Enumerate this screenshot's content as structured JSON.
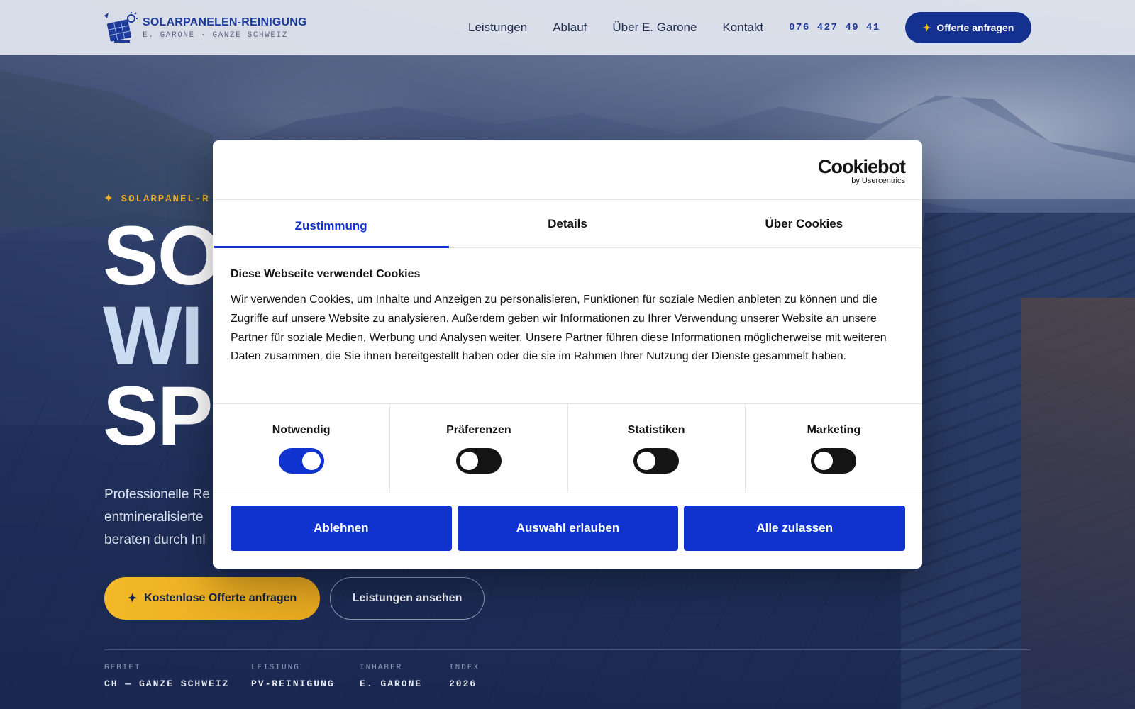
{
  "header": {
    "logo_title": "SOLARPANELEN-REINIGUNG",
    "logo_subtitle": "E. GARONE · GANZE SCHWEIZ",
    "nav": {
      "services": "Leistungen",
      "process": "Ablauf",
      "about": "Über E. Garone",
      "contact": "Kontakt",
      "phone": "076 427 49 41"
    },
    "cta": "Offerte anfragen"
  },
  "hero": {
    "eyebrow": "SOLARPANEL-R",
    "headline_line1": "SO",
    "headline_line2": "WI",
    "headline_line3": "SP",
    "lead_line1": "Professionelle Re",
    "lead_line2": "entmineralisierte",
    "lead_line3": "beraten durch Inl",
    "primary_button": "Kostenlose Offerte anfragen",
    "secondary_button": "Leistungen ansehen",
    "meta": [
      {
        "key": "GEBIET",
        "value": "CH — GANZE SCHWEIZ"
      },
      {
        "key": "LEISTUNG",
        "value": "PV-REINIGUNG"
      },
      {
        "key": "INHABER",
        "value": "E. GARONE"
      },
      {
        "key": "INDEX",
        "value": "2026"
      }
    ]
  },
  "cookie_dialog": {
    "brand_name": "Cookiebot",
    "brand_by": "by Usercentrics",
    "tabs": [
      "Zustimmung",
      "Details",
      "Über Cookies"
    ],
    "active_tab": "Zustimmung",
    "title": "Diese Webseite verwendet Cookies",
    "text": "Wir verwenden Cookies, um Inhalte und Anzeigen zu personalisieren, Funktionen für soziale Medien anbieten zu können und die Zugriffe auf unsere Website zu analysieren. Außerdem geben wir Informationen zu Ihrer Verwendung unserer Website an unsere Partner für soziale Medien, Werbung und Analysen weiter. Unsere Partner führen diese Informationen möglicherweise mit weiteren Daten zusammen, die Sie ihnen bereitgestellt haben oder die sie im Rahmen Ihrer Nutzung der Dienste gesammelt haben.",
    "categories": [
      {
        "label": "Notwendig",
        "enabled": true
      },
      {
        "label": "Präferenzen",
        "enabled": false
      },
      {
        "label": "Statistiken",
        "enabled": false
      },
      {
        "label": "Marketing",
        "enabled": false
      }
    ],
    "buttons": {
      "deny": "Ablehnen",
      "allow_selection": "Auswahl erlauben",
      "allow_all": "Alle zulassen"
    }
  },
  "colors": {
    "brand_blue": "#14318f",
    "accent_yellow": "#f3b928",
    "cookiebot_blue": "#1032cf"
  }
}
